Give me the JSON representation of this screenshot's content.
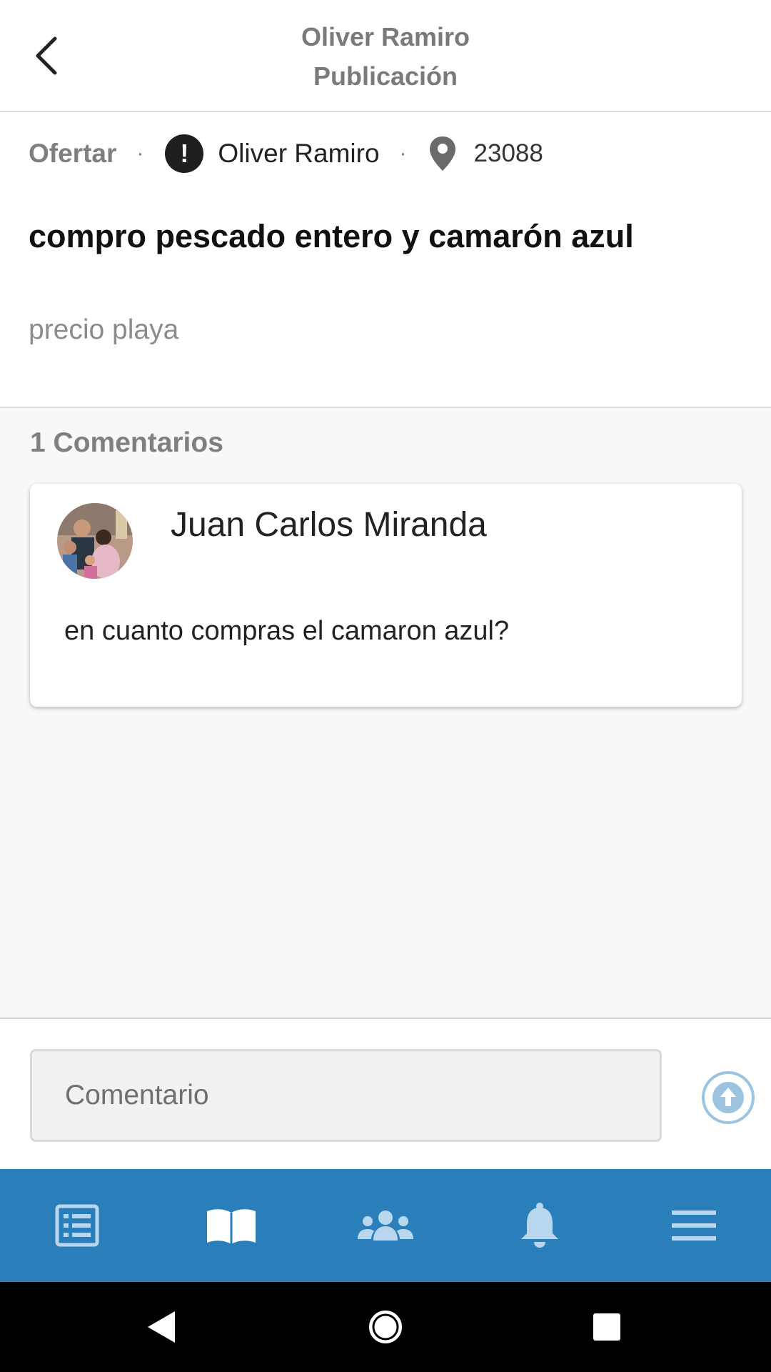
{
  "header": {
    "title": "Oliver Ramiro",
    "subtitle": "Publicación",
    "back_icon": "chevron-left-icon"
  },
  "post": {
    "type": "Ofertar",
    "separator": "·",
    "author": "Oliver Ramiro",
    "zip": "23088",
    "title": "compro pescado entero y camarón azul",
    "description": "precio playa"
  },
  "comments": {
    "count_label": "1 Comentarios",
    "items": [
      {
        "author": "Juan Carlos Miranda",
        "text": "en cuanto compras el camaron azul?"
      }
    ]
  },
  "compose": {
    "placeholder": "Comentario",
    "send_icon": "upload-arrow-icon"
  },
  "tabbar": {
    "background": "#2a7eb9",
    "icons": [
      "list-icon",
      "book-icon",
      "users-icon",
      "bell-icon",
      "menu-icon"
    ]
  },
  "system_nav": {
    "icons": [
      "back-triangle-icon",
      "home-circle-icon",
      "recents-square-icon"
    ]
  }
}
